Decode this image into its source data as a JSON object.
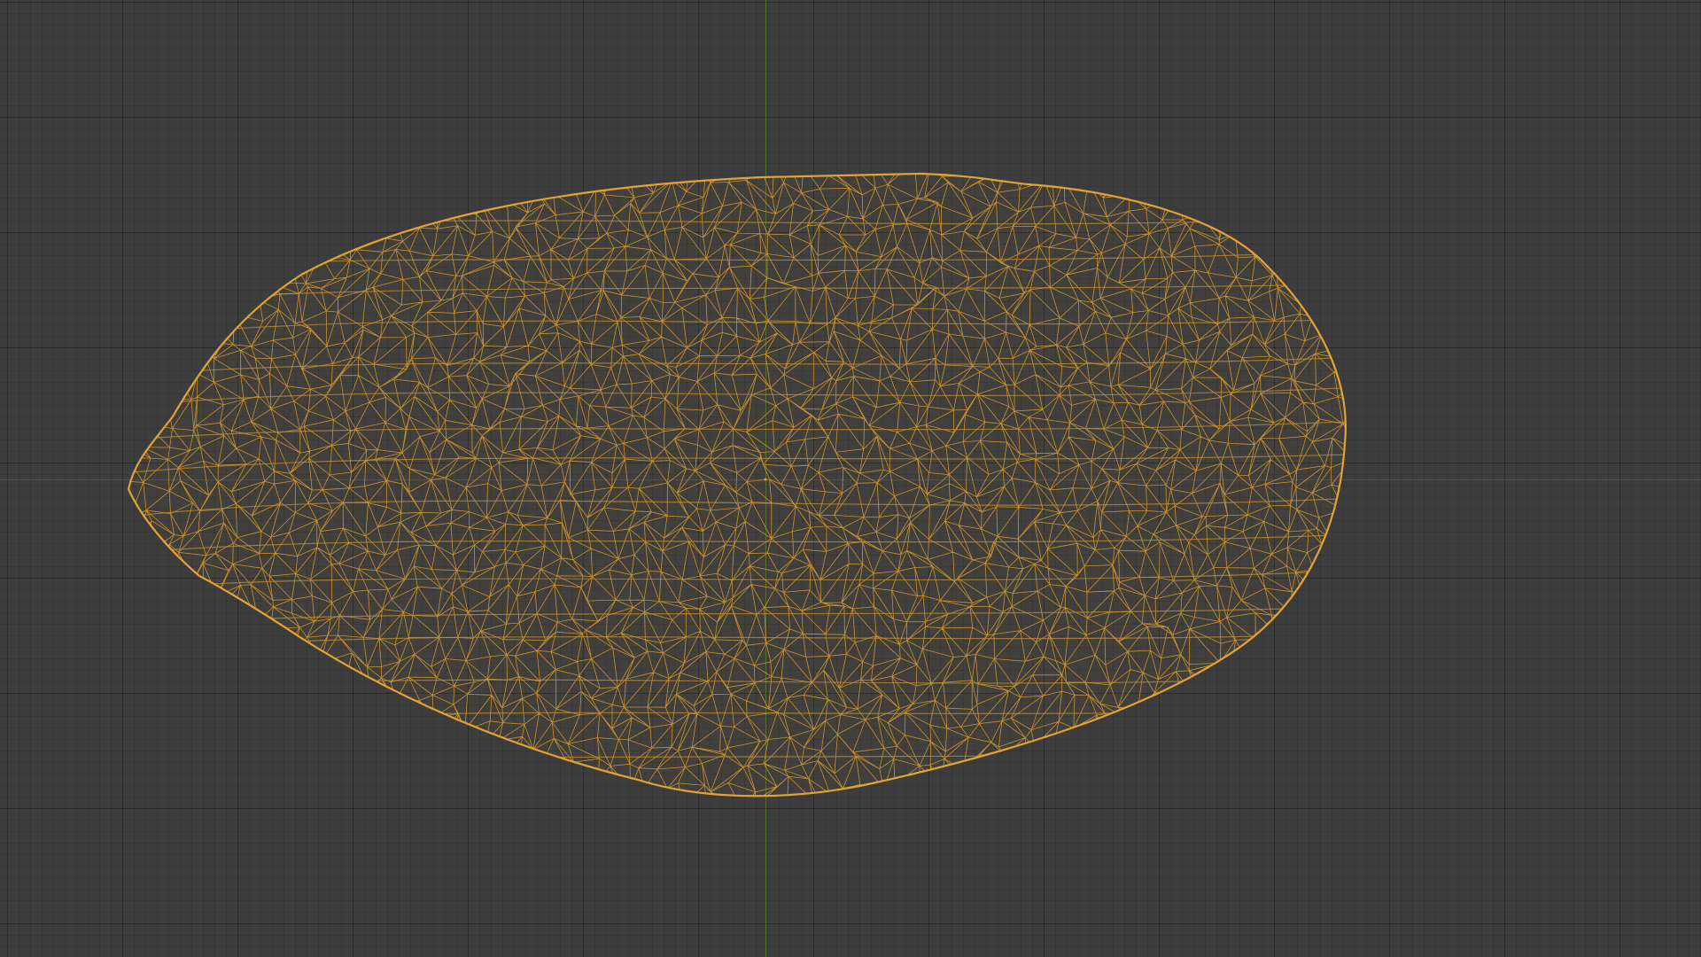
{
  "viewport": {
    "background": "#3d3d3d",
    "axis_x_color": "#aa3c3c",
    "axis_y_color": "#6e9632"
  },
  "mesh": {
    "object": "wireframe-seed-mesh",
    "wire_color": "#e0a030",
    "selected": true
  }
}
